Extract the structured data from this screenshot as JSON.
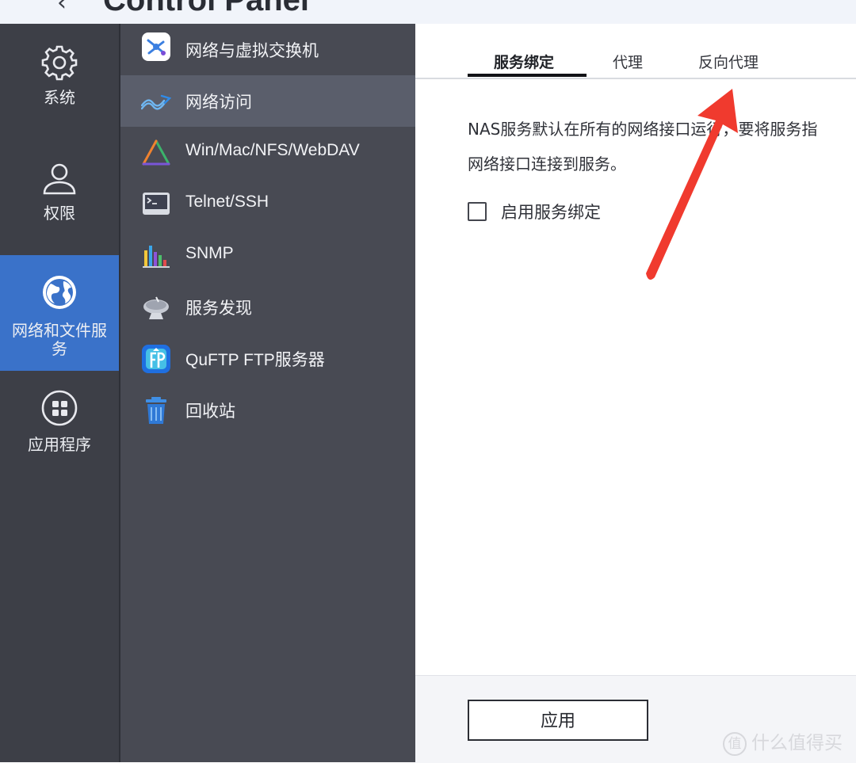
{
  "window": {
    "title": "Control Panel",
    "back_glyph": "‹"
  },
  "rail": {
    "items": [
      {
        "label": "系统",
        "icon": "gear-icon"
      },
      {
        "label": "权限",
        "icon": "user-icon"
      },
      {
        "label": "网络和文件服务",
        "icon": "globe-icon",
        "active": true
      },
      {
        "label": "应用程序",
        "icon": "apps-grid-icon"
      }
    ]
  },
  "menu": {
    "items": [
      {
        "label": "网络与虚拟交换机",
        "icon": "network-switch-icon"
      },
      {
        "label": "网络访问",
        "icon": "network-access-icon",
        "active": true
      },
      {
        "label": "Win/Mac/NFS/WebDAV",
        "icon": "file-protocol-icon"
      },
      {
        "label": "Telnet/SSH",
        "icon": "terminal-icon"
      },
      {
        "label": "SNMP",
        "icon": "snmp-chart-icon"
      },
      {
        "label": "服务发现",
        "icon": "satellite-dish-icon"
      },
      {
        "label": "QuFTP FTP服务器",
        "icon": "ftp-icon"
      },
      {
        "label": "回收站",
        "icon": "recycle-bin-icon"
      }
    ]
  },
  "tabs": [
    {
      "label": "服务绑定",
      "active": true
    },
    {
      "label": "代理"
    },
    {
      "label": "反向代理"
    }
  ],
  "content": {
    "description_line1": "NAS服务默认在所有的网络接口运行，要将服务指",
    "description_line2": "网络接口连接到服务。",
    "checkbox_label": "启用服务绑定",
    "checkbox_checked": false
  },
  "footer": {
    "apply_label": "应用"
  },
  "annotation": {
    "color": "#f03a2e"
  },
  "watermark": {
    "icon_glyph": "值",
    "text": "什么值得买"
  },
  "colors": {
    "rail_bg": "#3d3f47",
    "rail_active": "#3a72c9",
    "menu_bg": "#484a53",
    "menu_active": "#5a5e6b"
  }
}
